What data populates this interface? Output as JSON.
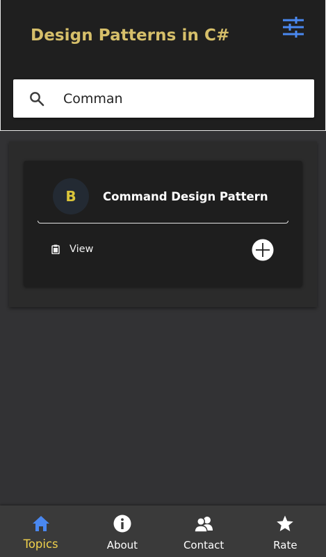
{
  "header": {
    "title": "Design Patterns in C#",
    "filter_icon": "tune-icon",
    "accent_color": "#d6bf6a",
    "icon_color": "#4a88f0"
  },
  "search": {
    "value": "Comman",
    "icon": "search-icon"
  },
  "results": [
    {
      "avatar_letter": "B",
      "title": "Command Design Pattern",
      "view_label": "View",
      "view_icon": "clipboard-icon",
      "add_icon": "add-circle-icon"
    }
  ],
  "bottom_nav": {
    "active_color": "#f1d24c",
    "items": [
      {
        "label": "Topics",
        "icon": "home-icon",
        "active": true
      },
      {
        "label": "About",
        "icon": "info-icon",
        "active": false
      },
      {
        "label": "Contact",
        "icon": "contacts-icon",
        "active": false
      },
      {
        "label": "Rate",
        "icon": "star-icon",
        "active": false
      }
    ]
  }
}
